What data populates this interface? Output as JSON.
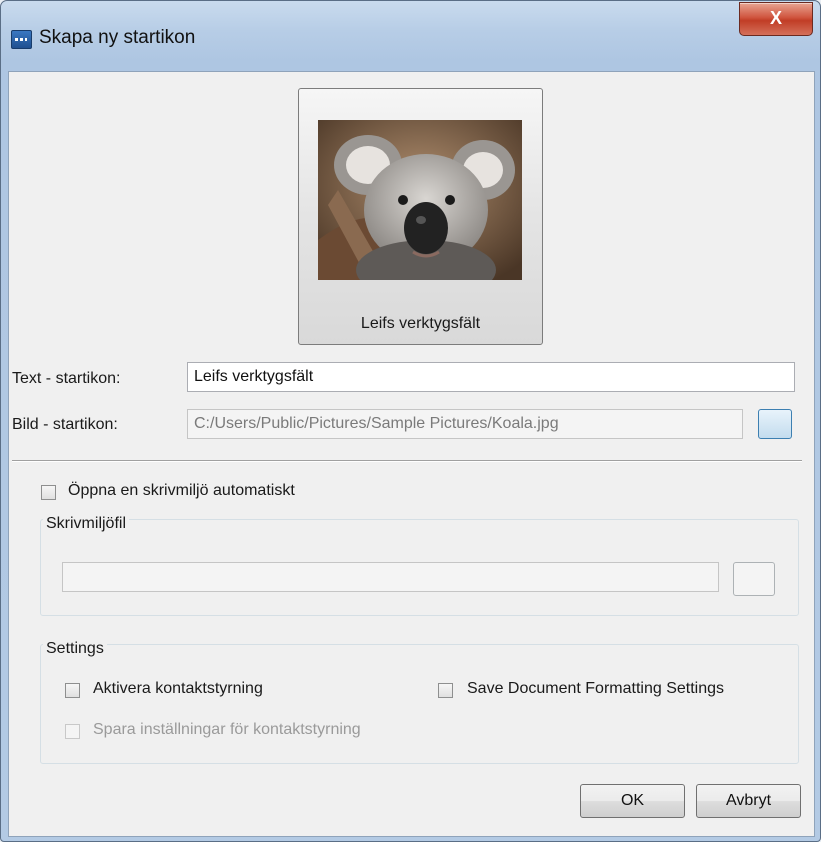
{
  "window": {
    "title": "Skapa ny startikon",
    "close_glyph": "X"
  },
  "preview": {
    "caption": "Leifs verktygsfält",
    "image_icon": "koala-photo"
  },
  "form": {
    "text_label": "Text - startikon:",
    "text_value": "Leifs verktygsfält",
    "image_label": "Bild - startikon:",
    "image_value": "C:/Users/Public/Pictures/Sample Pictures/Koala.jpg"
  },
  "auto_env": {
    "label": "Öppna en skrivmiljö automatiskt",
    "checked": false
  },
  "env_file": {
    "group_title": "Skrivmiljöfil",
    "value": ""
  },
  "settings": {
    "group_title": "Settings",
    "contact_control_label": "Aktivera kontaktstyrning",
    "save_formatting_label": "Save Document Formatting Settings",
    "save_contact_settings_label": "Spara inställningar för kontaktstyrning"
  },
  "buttons": {
    "ok": "OK",
    "cancel": "Avbryt"
  }
}
